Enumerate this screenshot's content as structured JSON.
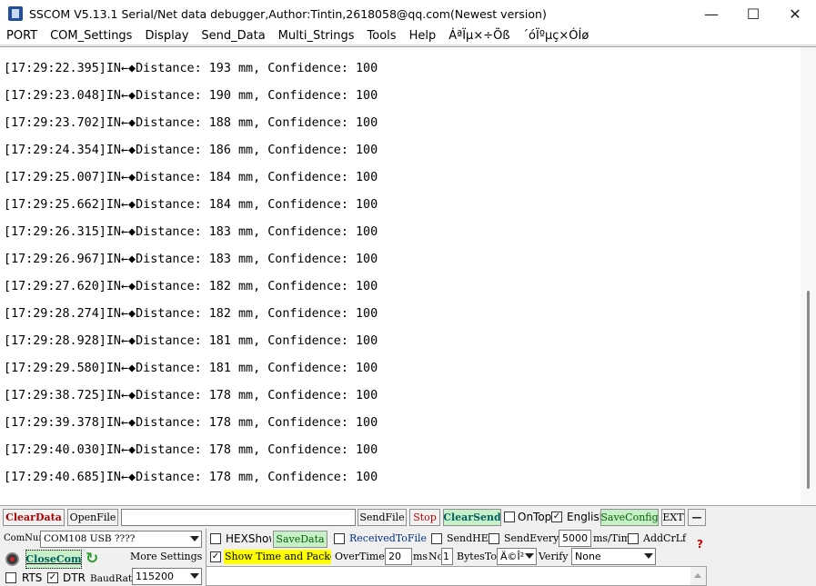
{
  "window": {
    "title": "SSCOM V5.13.1 Serial/Net data debugger,Author:Tintin,2618058@qq.com(Newest version)",
    "controls": {
      "minimize": "—",
      "maximize": "☐",
      "close": "✕"
    }
  },
  "menu": [
    "PORT",
    "COM_Settings",
    "Display",
    "Send_Data",
    "Multi_Strings",
    "Tools",
    "Help",
    "ÁªÏµ×÷Õß",
    "´óÏºµç×ÓÍø"
  ],
  "receive": {
    "lines": [
      "[17:29:22.395]IN←◆Distance: 193 mm, Confidence: 100",
      "[17:29:23.048]IN←◆Distance: 190 mm, Confidence: 100",
      "[17:29:23.702]IN←◆Distance: 188 mm, Confidence: 100",
      "[17:29:24.354]IN←◆Distance: 186 mm, Confidence: 100",
      "[17:29:25.007]IN←◆Distance: 184 mm, Confidence: 100",
      "[17:29:25.662]IN←◆Distance: 184 mm, Confidence: 100",
      "[17:29:26.315]IN←◆Distance: 183 mm, Confidence: 100",
      "[17:29:26.967]IN←◆Distance: 183 mm, Confidence: 100",
      "[17:29:27.620]IN←◆Distance: 182 mm, Confidence: 100",
      "[17:29:28.274]IN←◆Distance: 182 mm, Confidence: 100",
      "[17:29:28.928]IN←◆Distance: 181 mm, Confidence: 100",
      "[17:29:29.580]IN←◆Distance: 181 mm, Confidence: 100",
      "[17:29:38.725]IN←◆Distance: 178 mm, Confidence: 100",
      "[17:29:39.378]IN←◆Distance: 178 mm, Confidence: 100",
      "[17:29:40.030]IN←◆Distance: 178 mm, Confidence: 100",
      "[17:29:40.685]IN←◆Distance: 178 mm, Confidence: 100"
    ]
  },
  "toolbar": {
    "clear_data": "ClearData",
    "open_file": "OpenFile",
    "file_path": "",
    "send_file": "SendFile",
    "stop": "Stop",
    "clear_send": "ClearSend",
    "on_top": "OnTop",
    "on_top_checked": false,
    "english": "English",
    "english_checked": true,
    "save_config": "SaveConfig",
    "ext": "EXT",
    "collapse": "—"
  },
  "port": {
    "com_num_label": "ComNum",
    "com_value": "COM108 USB ????",
    "close_com": "CloseCom",
    "more_settings": "More Settings",
    "rts": "RTS",
    "rts_checked": false,
    "dtr": "DTR",
    "dtr_checked": true,
    "baud_label": "BaudRat",
    "baud_value": "115200"
  },
  "options": {
    "hex_show": "HEXShow",
    "hex_show_checked": false,
    "save_data": "SaveData",
    "received_to_file": "ReceivedToFile",
    "received_to_file_checked": false,
    "send_hex": "SendHEX",
    "send_hex_checked": false,
    "send_every": "SendEvery:",
    "send_every_checked": false,
    "interval_value": "5000",
    "interval_unit": "ms/Tim",
    "add_crlf": "AddCrLf",
    "add_crlf_checked": false,
    "show_time": "Show Time and Packe",
    "show_time_checked": true,
    "overtime_label": "OverTime:",
    "overtime_value": "20",
    "overtime_unit": "ms",
    "no_label": "No",
    "no_value": "1",
    "bytes_to_label": "BytesTo",
    "bytes_to_value": "Ä©Î²",
    "verify_label": "Verify",
    "verify_value": "None",
    "help_mark": "?"
  },
  "colors": {
    "clear_data_text": "#b00000",
    "stop_text": "#c00000",
    "green_button_bg": "#c8f0c8",
    "green_button_text": "#006400",
    "show_time_bg": "#ffff00",
    "recycle_icon": "#2e9e2e"
  }
}
